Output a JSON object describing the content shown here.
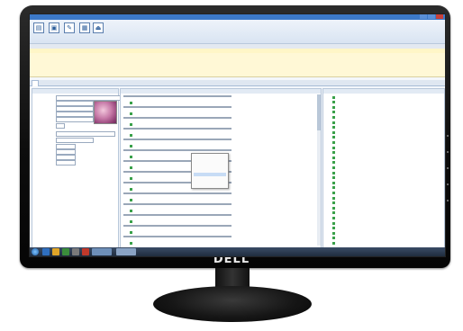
{
  "monitor": {
    "brand": "DELL"
  },
  "app": {
    "title": "",
    "toolbar": [
      "",
      "",
      "",
      "",
      ""
    ],
    "info_lines": [
      "",
      ""
    ]
  },
  "list": {
    "headers": [
      "",
      "",
      "",
      "",
      "",
      "",
      "",
      ""
    ],
    "row": [
      "",
      "",
      "",
      "",
      "",
      "",
      "",
      ""
    ]
  },
  "tabs": [
    "",
    ""
  ],
  "left_panel": {
    "title": "",
    "fields": [
      "",
      "",
      "",
      "",
      "",
      "",
      "",
      "",
      "",
      "",
      "",
      ""
    ]
  },
  "middle_panel": {
    "title": "",
    "context_menu": [
      "",
      "",
      "",
      "",
      "",
      "",
      ""
    ]
  },
  "right_panel": {
    "title": ""
  },
  "taskbar": {
    "clock": [
      "",
      ""
    ]
  }
}
